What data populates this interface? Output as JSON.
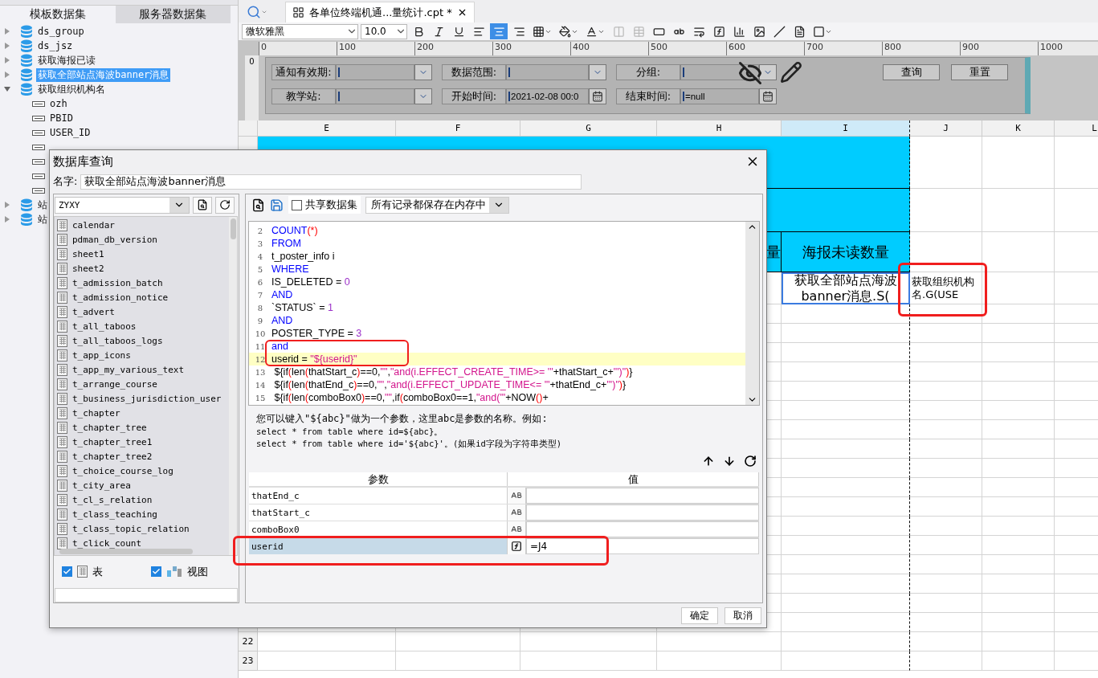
{
  "left_panel": {
    "tabs": [
      {
        "label": "模板数据集",
        "selected": true
      },
      {
        "label": "服务器数据集",
        "selected": false
      }
    ],
    "tree": [
      {
        "name": "ds_group",
        "expanded": false,
        "selected": false
      },
      {
        "name": "ds_jsz",
        "expanded": false,
        "selected": false
      },
      {
        "name": "获取海报已读",
        "expanded": false,
        "selected": false
      },
      {
        "name": "获取全部站点海波banner消息",
        "expanded": false,
        "selected": true
      },
      {
        "name": "获取组织机构名",
        "expanded": true,
        "selected": false,
        "children": [
          {
            "name": "ozh",
            "selected": false
          },
          {
            "name": "PBID",
            "selected": false
          },
          {
            "name": "USER_ID",
            "selected": false
          },
          {
            "selected": false
          },
          {
            "selected": false
          },
          {
            "selected": false
          },
          {
            "selected": false
          }
        ]
      },
      {
        "name": "站",
        "expanded": false,
        "selected": false
      },
      {
        "name": "站",
        "expanded": false,
        "selected": false
      }
    ]
  },
  "editor_tab": {
    "title": "各单位终端机通...量统计.cpt *"
  },
  "toolbar": {
    "font": "微软雅黑",
    "size": "10.0",
    "buttons": [
      {
        "selected": false,
        "disabled": false
      },
      {
        "selected": false,
        "disabled": false
      },
      {
        "selected": false,
        "disabled": false
      },
      {
        "selected": false,
        "disabled": false
      },
      {
        "selected": true,
        "disabled": false
      },
      {
        "selected": false,
        "disabled": false
      },
      {
        "selected": false,
        "disabled": false
      },
      {
        "selected": false,
        "disabled": false
      },
      {
        "selected": false,
        "disabled": false
      },
      {
        "selected": false,
        "disabled": true
      },
      {
        "selected": false,
        "disabled": true
      },
      {
        "selected": false,
        "disabled": false
      },
      {
        "selected": false,
        "disabled": false
      },
      {
        "selected": false,
        "disabled": false
      },
      {
        "selected": false,
        "disabled": false
      },
      {
        "selected": false,
        "disabled": false
      },
      {
        "selected": false,
        "disabled": false
      },
      {
        "selected": false,
        "disabled": false
      },
      {
        "selected": false,
        "disabled": false
      },
      {
        "selected": false,
        "disabled": false
      }
    ]
  },
  "form": {
    "ruler": [
      "0",
      "100",
      "200",
      "300",
      "400",
      "500",
      "600",
      "700",
      "800",
      "900",
      "1000"
    ],
    "ruler_vertical": "0",
    "fields": [
      {
        "label": "通知有效期:",
        "kind": "combo"
      },
      {
        "label": "数据范围:",
        "kind": "combo"
      },
      {
        "label": "分组:",
        "kind": "combo"
      },
      {
        "label": "教学站:",
        "kind": "combo"
      },
      {
        "label": "开始时间:",
        "kind": "date",
        "value": "2021-02-08 00:0"
      },
      {
        "label": "结束时间:",
        "kind": "date",
        "value": "=null"
      }
    ],
    "buttons": [
      "查询",
      "重置"
    ]
  },
  "sheet": {
    "columns": [
      {
        "label": "E",
        "selected": false
      },
      {
        "label": "F",
        "selected": false
      },
      {
        "label": "G",
        "selected": false
      },
      {
        "label": "H",
        "selected": false
      },
      {
        "label": "I",
        "selected": true
      },
      {
        "label": "J",
        "selected": false
      },
      {
        "label": "K",
        "selected": false
      },
      {
        "label": "L",
        "selected": false
      }
    ],
    "rows": [
      {
        "kind": "title"
      },
      {
        "kind": "title"
      },
      {
        "kind": "header",
        "cells": [
          {},
          {},
          {},
          {
            "text": "量"
          },
          {
            "text": "海报未读数量"
          },
          {},
          {},
          {}
        ]
      },
      {
        "kind": "data",
        "cells": [
          {},
          {},
          {},
          {},
          {
            "text": "获取全部站点海波banner消息.S(",
            "selected": true
          },
          {
            "text": "获取组织机构名.G(USE",
            "selected": false
          },
          {
            "selected": false
          },
          {
            "selected": false
          }
        ]
      },
      {
        "kind": "blank"
      },
      {
        "kind": "blank"
      },
      {
        "kind": "blank"
      },
      {
        "kind": "blank"
      },
      {
        "kind": "blank"
      },
      {
        "kind": "blank"
      },
      {
        "kind": "blank"
      },
      {
        "kind": "blank"
      },
      {
        "kind": "blank"
      },
      {
        "kind": "blank"
      },
      {
        "kind": "blank"
      },
      {
        "kind": "blank"
      },
      {
        "kind": "blank"
      },
      {
        "kind": "blank"
      },
      {
        "kind": "blank"
      },
      {
        "kind": "blank"
      },
      {
        "kind": "blank"
      },
      {
        "kind": "blank",
        "number": "22"
      },
      {
        "kind": "blank",
        "number": "23"
      }
    ]
  },
  "dialog": {
    "title": "数据库查询",
    "name_label": "名字:",
    "name_value": "获取全部站点海波banner消息",
    "connection": "ZYXY",
    "tables": [
      "calendar",
      "pdman_db_version",
      "sheet1",
      "sheet2",
      "t_admission_batch",
      "t_admission_notice",
      "t_advert",
      "t_all_taboos",
      "t_all_taboos_logs",
      "t_app_icons",
      "t_app_my_various_text",
      "t_arrange_course",
      "t_business_jurisdiction_user",
      "t_chapter",
      "t_chapter_tree",
      "t_chapter_tree1",
      "t_chapter_tree2",
      "t_choice_course_log",
      "t_city_area",
      "t_cl_s_relation",
      "t_class_teaching",
      "t_class_topic_relation",
      "t_click_count"
    ],
    "filters": [
      {
        "label": "表",
        "checked": true
      },
      {
        "label": "视图",
        "checked": true
      }
    ],
    "shared_dataset": {
      "label": "共享数据集",
      "checked": false
    },
    "cache_mode": "所有记录都保存在内存中",
    "code_lines": [
      {
        "number": "2",
        "highlighted": false,
        "tokens": [
          {
            "kind": "keyword",
            "text": "COUNT"
          },
          {
            "kind": "paren",
            "text": "(*)"
          }
        ]
      },
      {
        "number": "3",
        "highlighted": false,
        "tokens": [
          {
            "kind": "keyword",
            "text": "FROM"
          }
        ]
      },
      {
        "number": "4",
        "highlighted": false,
        "tokens": [
          {
            "kind": "plain",
            "text": "t_poster_info i"
          }
        ]
      },
      {
        "number": "5",
        "highlighted": false,
        "tokens": [
          {
            "kind": "keyword",
            "text": "WHERE"
          }
        ]
      },
      {
        "number": "6",
        "highlighted": false,
        "tokens": [
          {
            "kind": "plain",
            "text": "IS_DELETED = "
          },
          {
            "kind": "number",
            "text": "0"
          }
        ]
      },
      {
        "number": "7",
        "highlighted": false,
        "tokens": [
          {
            "kind": "keyword",
            "text": "AND"
          }
        ]
      },
      {
        "number": "8",
        "highlighted": false,
        "tokens": [
          {
            "kind": "plain",
            "text": "`STATUS` = "
          },
          {
            "kind": "number",
            "text": "1"
          }
        ]
      },
      {
        "number": "9",
        "highlighted": false,
        "tokens": [
          {
            "kind": "keyword",
            "text": "AND"
          }
        ]
      },
      {
        "number": "10",
        "highlighted": false,
        "tokens": [
          {
            "kind": "plain",
            "text": "POSTER_TYPE = "
          },
          {
            "kind": "number",
            "text": "3"
          }
        ]
      },
      {
        "number": "11",
        "highlighted": false,
        "tokens": [
          {
            "kind": "keyword",
            "text": "and"
          }
        ]
      },
      {
        "number": "12",
        "highlighted": true,
        "tokens": [
          {
            "kind": "plain",
            "text": "userid = "
          },
          {
            "kind": "string",
            "text": "\"${userid}\""
          }
        ]
      },
      {
        "number": "13",
        "highlighted": false,
        "tokens": [
          {
            "kind": "plain",
            "text": " ${if"
          },
          {
            "kind": "paren",
            "text": "("
          },
          {
            "kind": "plain",
            "text": "len"
          },
          {
            "kind": "paren",
            "text": "("
          },
          {
            "kind": "plain",
            "text": "thatStart_c"
          },
          {
            "kind": "paren",
            "text": ")"
          },
          {
            "kind": "plain",
            "text": "==0,"
          },
          {
            "kind": "string",
            "text": "\"\""
          },
          {
            "kind": "plain",
            "text": ","
          },
          {
            "kind": "string",
            "text": "\"and(i.EFFECT_CREATE_TIME>= '\""
          },
          {
            "kind": "plain",
            "text": "+thatStart_c+"
          },
          {
            "kind": "string",
            "text": "\"')\""
          },
          {
            "kind": "paren",
            "text": ")"
          },
          {
            "kind": "plain",
            "text": "}"
          }
        ]
      },
      {
        "number": "14",
        "highlighted": false,
        "tokens": [
          {
            "kind": "plain",
            "text": " ${if"
          },
          {
            "kind": "paren",
            "text": "("
          },
          {
            "kind": "plain",
            "text": "len"
          },
          {
            "kind": "paren",
            "text": "("
          },
          {
            "kind": "plain",
            "text": "thatEnd_c"
          },
          {
            "kind": "paren",
            "text": ")"
          },
          {
            "kind": "plain",
            "text": "==0,"
          },
          {
            "kind": "string",
            "text": "\"\""
          },
          {
            "kind": "plain",
            "text": ","
          },
          {
            "kind": "string",
            "text": "\"and(i.EFFECT_UPDATE_TIME<= '\""
          },
          {
            "kind": "plain",
            "text": "+thatEnd_c+"
          },
          {
            "kind": "string",
            "text": "\"')\""
          },
          {
            "kind": "paren",
            "text": ")"
          },
          {
            "kind": "plain",
            "text": "}"
          }
        ]
      },
      {
        "number": "15",
        "highlighted": false,
        "tokens": [
          {
            "kind": "plain",
            "text": " ${if"
          },
          {
            "kind": "paren",
            "text": "("
          },
          {
            "kind": "plain",
            "text": "len"
          },
          {
            "kind": "paren",
            "text": "("
          },
          {
            "kind": "plain",
            "text": "comboBox0"
          },
          {
            "kind": "paren",
            "text": ")"
          },
          {
            "kind": "plain",
            "text": "==0,"
          },
          {
            "kind": "string",
            "text": "\"\""
          },
          {
            "kind": "plain",
            "text": ",if"
          },
          {
            "kind": "paren",
            "text": "("
          },
          {
            "kind": "plain",
            "text": "comboBox0==1,"
          },
          {
            "kind": "string",
            "text": "\"and('\""
          },
          {
            "kind": "plain",
            "text": "+NOW"
          },
          {
            "kind": "paren",
            "text": "()"
          },
          {
            "kind": "plain",
            "text": "+"
          }
        ]
      }
    ],
    "hint": [
      "您可以键入\"${abc}\"做为一个参数，这里abc是参数的名称。例如:",
      "select * from table where id=${abc}。",
      "select * from table where id='${abc}'。(如果id字段为字符串类型)"
    ],
    "params": {
      "columns": [
        "参数",
        "值"
      ],
      "rows": [
        {
          "name": "thatEnd_c",
          "kind": "text",
          "selected": false
        },
        {
          "name": "thatStart_c",
          "kind": "text",
          "selected": false
        },
        {
          "name": "comboBox0",
          "kind": "text",
          "selected": false
        },
        {
          "name": "userid",
          "kind": "formula",
          "value": "=J4",
          "selected": true
        }
      ]
    },
    "buttons": [
      "确定",
      "取消"
    ]
  },
  "highlights": [
    {
      "kind": "code-line"
    },
    {
      "kind": "cell"
    },
    {
      "kind": "param-row"
    }
  ]
}
